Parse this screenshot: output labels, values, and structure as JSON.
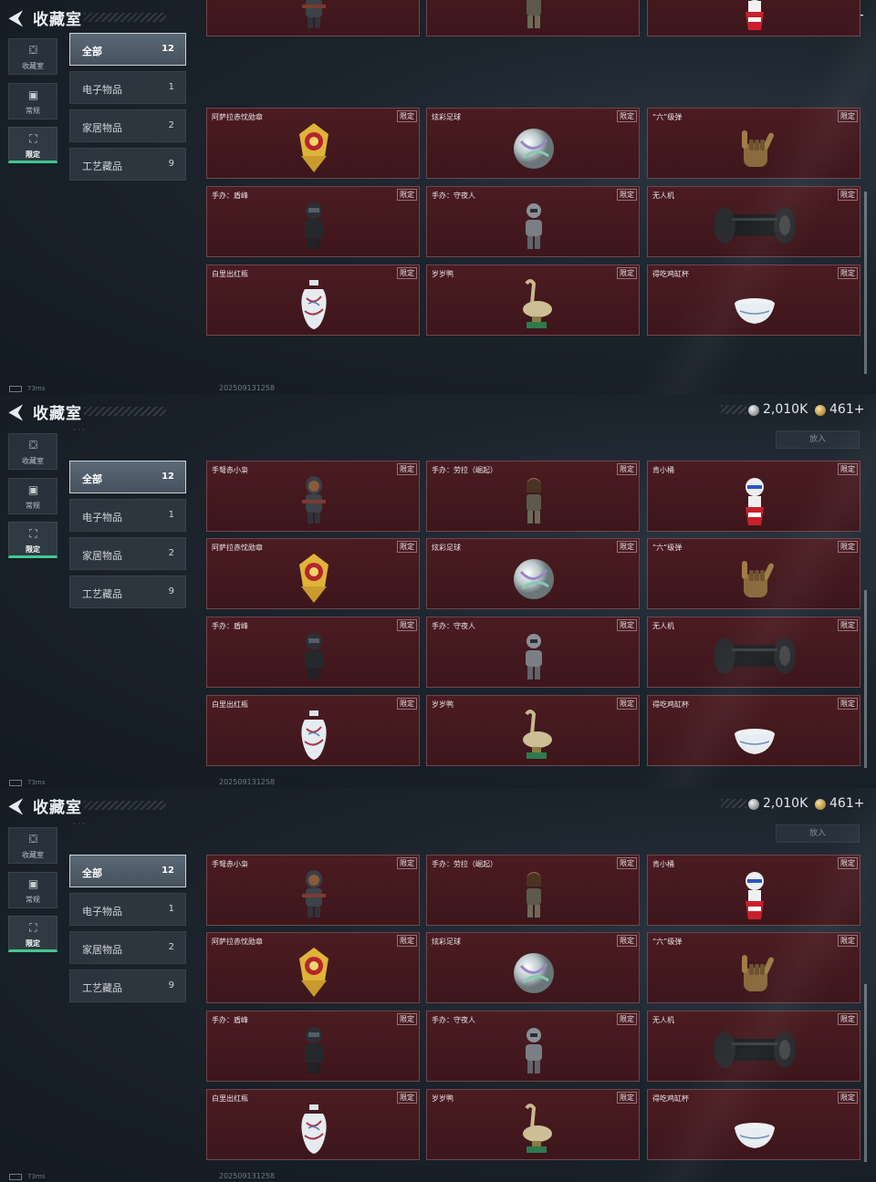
{
  "header": {
    "title": "收藏室",
    "currency_silver": "2,010K",
    "currency_gold": "461+"
  },
  "side_tabs": [
    {
      "label": "收藏室",
      "icon": "collection-icon"
    },
    {
      "label": "常规",
      "icon": "regular-icon"
    },
    {
      "label": "限定",
      "icon": "limited-icon"
    }
  ],
  "categories": [
    {
      "label": "全部",
      "count": "12"
    },
    {
      "label": "电子物品",
      "count": "1"
    },
    {
      "label": "家居物品",
      "count": "2"
    },
    {
      "label": "工艺藏品",
      "count": "9"
    }
  ],
  "items": [
    {
      "name": "手弩赤小枭",
      "tag": "限定",
      "icon": "figure-red-owl-icon"
    },
    {
      "name": "手办：劳拉（崛起）",
      "tag": "限定",
      "icon": "figure-lara-icon"
    },
    {
      "name": "肯小桶",
      "tag": "限定",
      "icon": "kfc-bucket-icon"
    },
    {
      "name": "阿萨拉赤忱勋章",
      "tag": "限定",
      "icon": "medal-icon"
    },
    {
      "name": "炫彩足球",
      "tag": "限定",
      "icon": "football-icon"
    },
    {
      "name": "“六”级弹",
      "tag": "限定",
      "icon": "six-hand-icon"
    },
    {
      "name": "手办：盾峰",
      "tag": "限定",
      "icon": "figure-shield-icon"
    },
    {
      "name": "手办：守夜人",
      "tag": "限定",
      "icon": "figure-nightwatch-icon"
    },
    {
      "name": "无人机",
      "tag": "限定",
      "icon": "drone-roller-icon"
    },
    {
      "name": "白里出红瓶",
      "tag": "限定",
      "icon": "porcelain-vase-icon"
    },
    {
      "name": "岁岁鸭",
      "tag": "限定",
      "icon": "duck-statue-icon"
    },
    {
      "name": "得吃鸡缸杯",
      "tag": "限定",
      "icon": "porcelain-cup-icon"
    }
  ],
  "put_in_label": "放入",
  "status": {
    "ping": "73ms",
    "timestamp": "202509131258"
  },
  "colors": {
    "card_bg": "#4b1c22",
    "active_tab_underline": "#43c78f"
  }
}
